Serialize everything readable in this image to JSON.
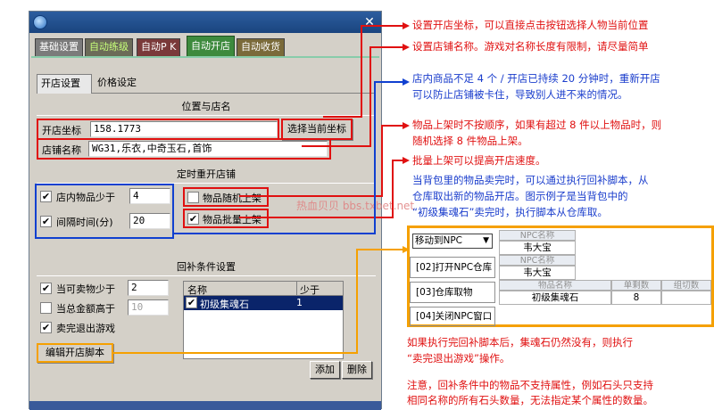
{
  "window": {
    "close_glyph": "✕",
    "tabs": [
      "基础设置",
      "自动练级",
      "自动P K",
      "自动开店",
      "自动收货"
    ],
    "subtabs": [
      "开店设置",
      "价格设定"
    ],
    "section_location": "位置与店名",
    "shop_coord_label": "开店坐标",
    "shop_coord_value": "158.1773",
    "select_coord_button": "选择当前坐标",
    "shop_name_label": "店铺名称",
    "shop_name_value": "WG31,乐衣,中奇玉石,首饰",
    "section_timer": "定时重开店铺",
    "items_less_label": "店内物品少于",
    "items_less_value": "4",
    "interval_label": "间隔时间(分)",
    "interval_value": "20",
    "random_list_label": "物品随机上架",
    "batch_list_label": "物品批量上架",
    "section_restock": "回补条件设置",
    "sellable_less_label": "当可卖物少于",
    "sellable_less_value": "2",
    "gold_above_label": "当总金额高于",
    "gold_above_value": "10",
    "exit_after_label": "卖完退出游戏",
    "list_col_name": "名称",
    "list_col_less": "少于",
    "list_item_name": "初级集魂石",
    "list_item_value": "1",
    "edit_script_button": "编辑开店脚本",
    "add_button": "添加",
    "delete_button": "删除",
    "checks": {
      "items_less": "✔",
      "interval": "✔",
      "random": "",
      "batch": "✔",
      "sellable": "✔",
      "gold": "",
      "exit_after": "✔",
      "list_item": "✔"
    }
  },
  "watermark": "热血贝贝 bbs.txbet.net",
  "annotations": {
    "a1": "设置开店坐标，可以直接点击按钮选择人物当前位置",
    "a2": "设置店铺名称。游戏对名称长度有限制，请尽量简单",
    "a3_line1": "店内商品不足 4 个 / 开店已持续 20 分钟时，重新开店",
    "a3_line2": "可以防止店铺被卡住，导致别人进不来的情况。",
    "a4_line1": "物品上架时不按顺序，如果有超过 8 件以上物品时，则",
    "a4_line2": "随机选择 8 件物品上架。",
    "a5": "批量上架可以提高开店速度。",
    "a6_line1": "当背包里的物品卖完时，可以通过执行回补脚本，从",
    "a6_line2": "仓库取出新的物品开店。图示例子是当背包中的",
    "a6_line3": "“初级集魂石”卖完时，执行脚本从仓库取。",
    "a7_line1": "如果执行完回补脚本后，集魂石仍然没有，则执行",
    "a7_line2": "“卖完退出游戏”操作。",
    "a8_line1": "注意，回补条件中的物品不支持属性，例如石头只支持",
    "a8_line2": "相同名称的所有石头数量，无法指定某个属性的数量。"
  },
  "script_table": {
    "row1_action": "移动到NPC",
    "npc_header": "NPC名称",
    "npc_name1": "韦大宝",
    "row2_action": "[02]打开NPC仓库",
    "npc_name2": "韦大宝",
    "row3_action": "[03]仓库取物",
    "item_header": "物品名称",
    "remain_header": "单剩数",
    "group_header": "组切数",
    "item_name": "初级集魂石",
    "item_count": "8",
    "row4_action": "[04]关闭NPC窗口"
  }
}
